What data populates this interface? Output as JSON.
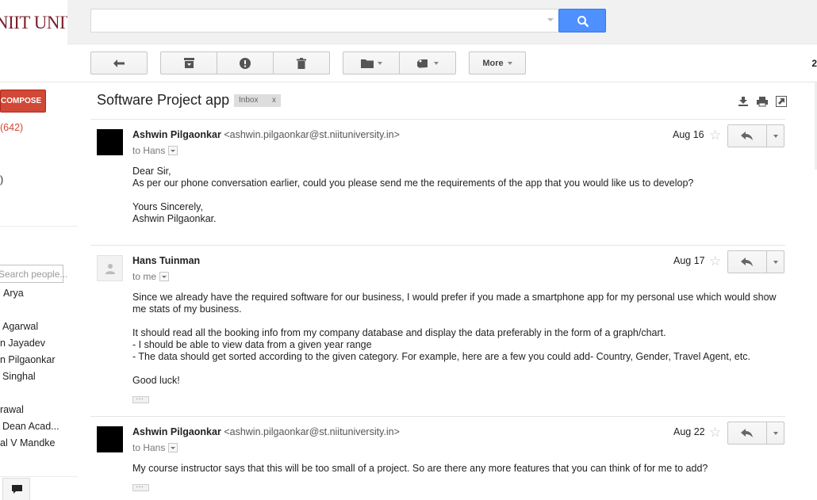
{
  "header": {
    "logo_text": "NIIT UNIVERSITY",
    "search": {
      "value": "",
      "placeholder": ""
    }
  },
  "toolbar": {
    "more_label": "More",
    "page_count": "2"
  },
  "left_nav": {
    "compose_label": "COMPOSE",
    "inbox_count": "(642)",
    "other_count": ")",
    "people_search_placeholder": "Search people...",
    "contacts": [
      "Arya",
      "Agarwal",
      "n Jayadev",
      "n Pilgaonkar",
      "Singhal",
      "rawal",
      "Dean Acad...",
      "al V Mandke"
    ]
  },
  "thread": {
    "subject": "Software Project app",
    "label": "Inbox",
    "label_close": "x",
    "messages": [
      {
        "sender_name": "Ashwin Pilgaonkar",
        "sender_email": "<ashwin.pilgaonkar@st.niituniversity.in>",
        "recipient": "to Hans",
        "date": "Aug 16",
        "body": [
          "Dear Sir,",
          "As per our phone conversation earlier, could you please send me the requirements of the app that you would like us to develop?",
          "",
          "Yours Sincerely,",
          "Ashwin Pilgaonkar."
        ]
      },
      {
        "sender_name": "Hans Tuinman",
        "sender_email": "",
        "recipient": "to me",
        "date": "Aug 17",
        "body": [
          "Since we already have the required software for our business, I would prefer if you made a smartphone app for my personal use which would show me stats of my business.",
          "",
          "It should read all the booking info from my company database and display the data preferably in the form of a graph/chart.",
          "- I should be able to view data from a given year range",
          "- The data should get sorted according to the given category. For example, here are a few you could add- Country, Gender, Travel Agent, etc.",
          "",
          "Good luck!"
        ]
      },
      {
        "sender_name": "Ashwin Pilgaonkar",
        "sender_email": "<ashwin.pilgaonkar@st.niituniversity.in>",
        "recipient": "to Hans",
        "date": "Aug 22",
        "body": [
          "My course instructor says that this will be too small of a project. So are there any more features that you can think of for me to add?"
        ]
      }
    ]
  },
  "colors": {
    "compose": "#d14836",
    "search_button": "#4d90fe",
    "logo": "#7a1f2b"
  }
}
